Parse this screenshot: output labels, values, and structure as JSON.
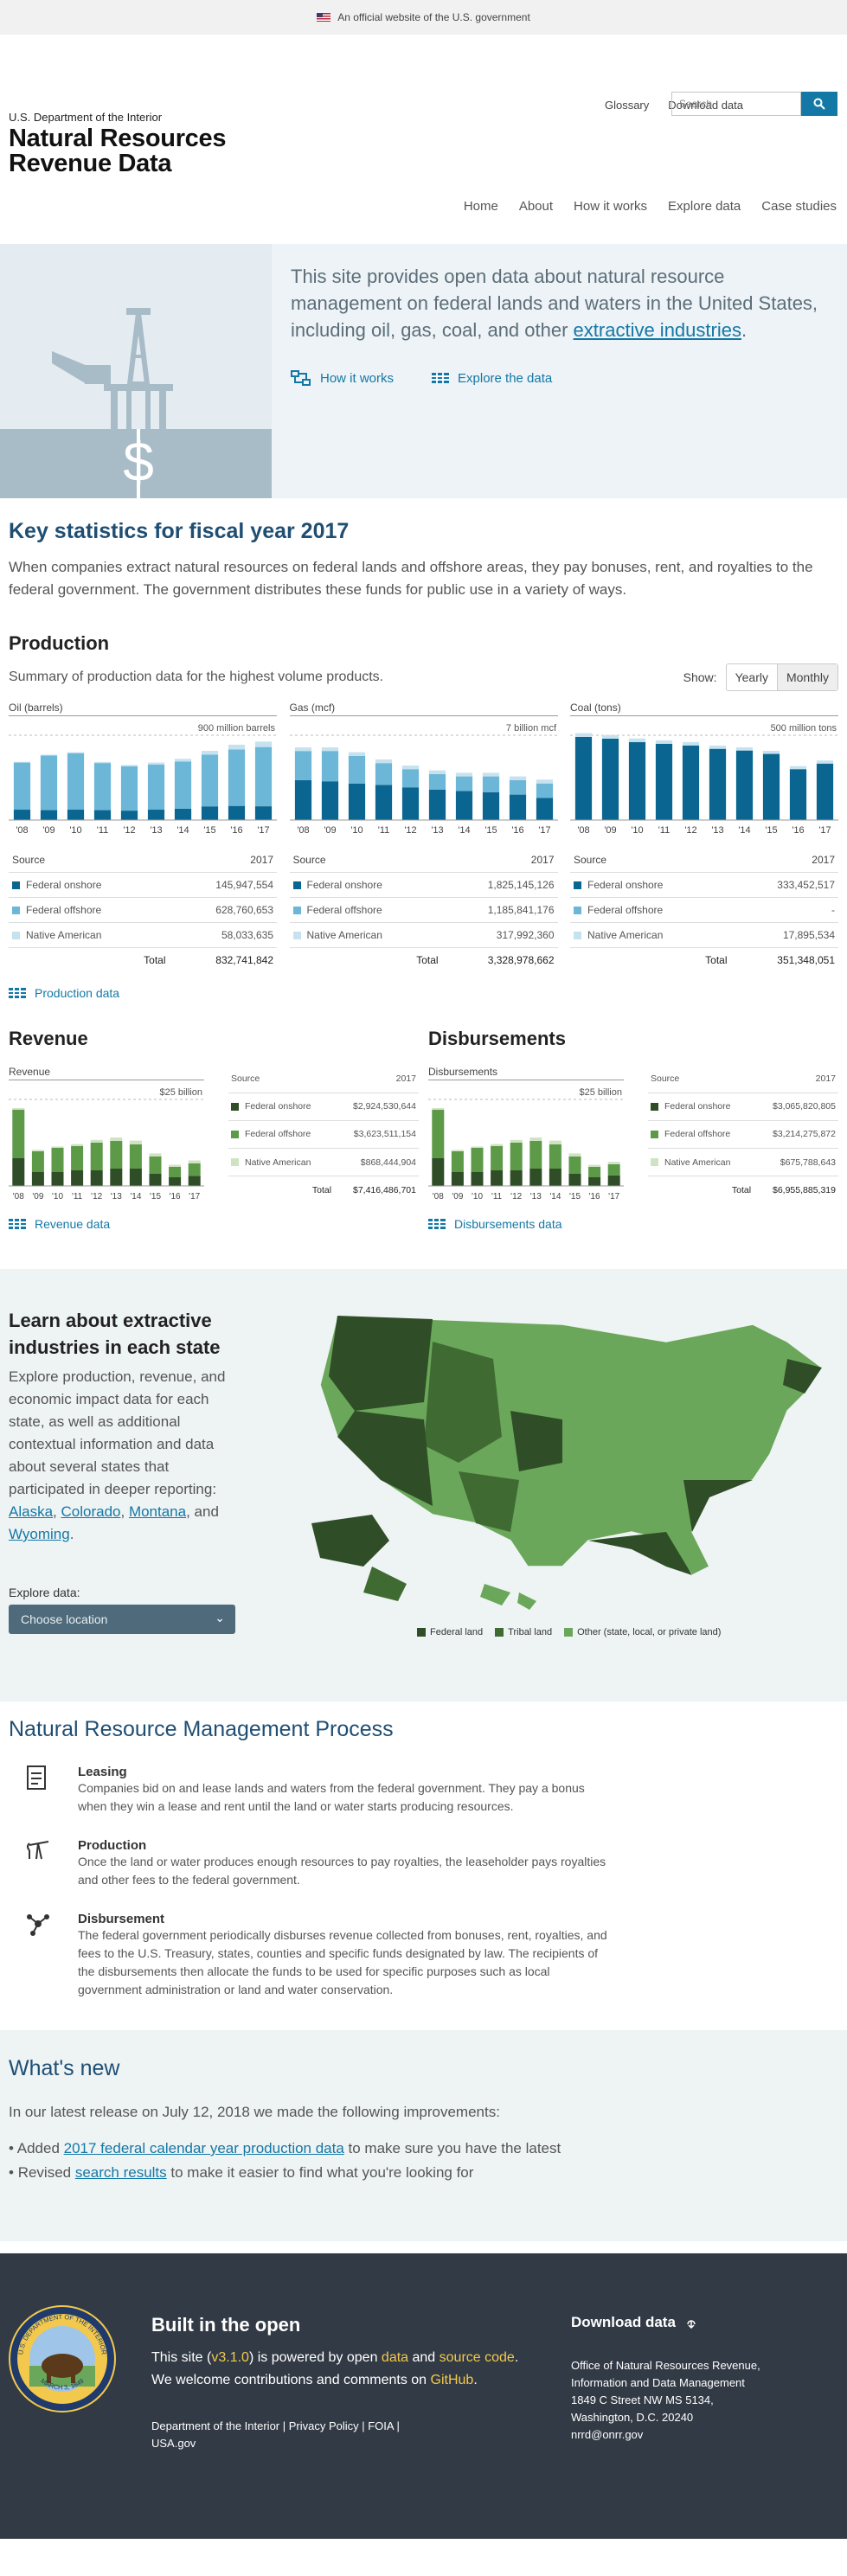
{
  "banner": {
    "text": "An official website of the U.S. government"
  },
  "header": {
    "department": "U.S. Department of the Interior",
    "title_line1": "Natural Resources",
    "title_line2": "Revenue Data",
    "glossary": "Glossary",
    "download": "Download data",
    "search_placeholder": "Search"
  },
  "nav": [
    "Home",
    "About",
    "How it works",
    "Explore data",
    "Case studies"
  ],
  "hero": {
    "text_before": "This site provides open data about natural resource management on federal lands and waters in the United States, including oil, gas, coal, and other ",
    "text_link": "extractive industries",
    "text_after": ".",
    "how_it_works": "How it works",
    "explore": "Explore the data"
  },
  "key": {
    "title": "Key statistics for fiscal year 2017",
    "desc": "When companies extract natural resources on federal lands and offshore areas, they pay bonuses, rent, and royalties to the federal government. The government distributes these funds for public use in a variety of ways."
  },
  "production": {
    "title": "Production",
    "desc": "Summary of production data for the highest volume products.",
    "show": "Show:",
    "yearly": "Yearly",
    "monthly": "Monthly",
    "link": "Production data"
  },
  "colors": {
    "onshore": "#0a6690",
    "offshore": "#6cb6d8",
    "native": "#c6e2ef",
    "rev_onshore": "#2f4d26",
    "rev_offshore": "#5c9a48",
    "rev_native": "#cfe3c3",
    "fed_land": "#2f4d26",
    "tribal": "#3f6b32",
    "other": "#6aa75a"
  },
  "tables": {
    "source": "Source",
    "year": "2017",
    "onshore": "Federal onshore",
    "offshore": "Federal offshore",
    "native": "Native American",
    "total": "Total"
  },
  "chart_data": [
    {
      "type": "bar",
      "title": "Oil (barrels)",
      "max_label": "900 million barrels",
      "categories": [
        "'08",
        "'09",
        "'10",
        "'11",
        "'12",
        "'13",
        "'14",
        "'15",
        "'16",
        "'17"
      ],
      "series": [
        {
          "name": "Federal onshore",
          "values": [
            110,
            105,
            110,
            105,
            100,
            110,
            120,
            145,
            150,
            146
          ]
        },
        {
          "name": "Federal offshore",
          "values": [
            500,
            580,
            600,
            500,
            470,
            480,
            500,
            550,
            600,
            629
          ]
        },
        {
          "name": "Native American",
          "values": [
            8,
            9,
            10,
            12,
            15,
            20,
            30,
            40,
            50,
            58
          ]
        }
      ],
      "ylim": [
        0,
        900
      ],
      "table": [
        "145,947,554",
        "628,760,653",
        "58,033,635",
        "832,741,842"
      ]
    },
    {
      "type": "bar",
      "title": "Gas (mcf)",
      "max_label": "7 billion mcf",
      "categories": [
        "'08",
        "'09",
        "'10",
        "'11",
        "'12",
        "'13",
        "'14",
        "'15",
        "'16",
        "'17"
      ],
      "series": [
        {
          "name": "Federal onshore",
          "values": [
            3.3,
            3.2,
            3.0,
            2.9,
            2.7,
            2.5,
            2.4,
            2.3,
            2.1,
            1.83
          ]
        },
        {
          "name": "Federal offshore",
          "values": [
            2.4,
            2.5,
            2.3,
            1.8,
            1.5,
            1.3,
            1.2,
            1.3,
            1.2,
            1.19
          ]
        },
        {
          "name": "Native American",
          "values": [
            0.3,
            0.3,
            0.3,
            0.3,
            0.3,
            0.3,
            0.3,
            0.3,
            0.3,
            0.32
          ]
        }
      ],
      "ylim": [
        0,
        7
      ],
      "table": [
        "1,825,145,126",
        "1,185,841,176",
        "317,992,360",
        "3,328,978,662"
      ]
    },
    {
      "type": "bar",
      "title": "Coal (tons)",
      "max_label": "500 million tons",
      "categories": [
        "'08",
        "'09",
        "'10",
        "'11",
        "'12",
        "'13",
        "'14",
        "'15",
        "'16",
        "'17"
      ],
      "series": [
        {
          "name": "Federal onshore",
          "values": [
            490,
            480,
            460,
            450,
            440,
            420,
            410,
            390,
            300,
            333
          ]
        },
        {
          "name": "Federal offshore",
          "values": [
            0,
            0,
            0,
            0,
            0,
            0,
            0,
            0,
            0,
            0
          ]
        },
        {
          "name": "Native American",
          "values": [
            22,
            21,
            21,
            20,
            20,
            19,
            19,
            18,
            18,
            18
          ]
        }
      ],
      "ylim": [
        0,
        500
      ],
      "table": [
        "333,452,517",
        "-",
        "17,895,534",
        "351,348,051"
      ]
    },
    {
      "type": "bar",
      "title": "Revenue",
      "max_label": "$25 billion",
      "categories": [
        "'08",
        "'09",
        "'10",
        "'11",
        "'12",
        "'13",
        "'14",
        "'15",
        "'16",
        "'17"
      ],
      "series": [
        {
          "name": "Federal onshore",
          "values": [
            8,
            4,
            4,
            4.5,
            4.5,
            5,
            5,
            3.5,
            2.5,
            2.9
          ]
        },
        {
          "name": "Federal offshore",
          "values": [
            14,
            6,
            7,
            7,
            8,
            8,
            7,
            5,
            3,
            3.6
          ]
        },
        {
          "name": "Native American",
          "values": [
            0.5,
            0.4,
            0.4,
            0.6,
            0.8,
            1.0,
            1.1,
            0.9,
            0.6,
            0.87
          ]
        }
      ],
      "ylim": [
        0,
        25
      ],
      "table": [
        "$2,924,530,644",
        "$3,623,511,154",
        "$868,444,904",
        "$7,416,486,701"
      ],
      "link": "Revenue data",
      "section_title": "Revenue"
    },
    {
      "type": "bar",
      "title": "Disbursements",
      "max_label": "$25 billion",
      "categories": [
        "'08",
        "'09",
        "'10",
        "'11",
        "'12",
        "'13",
        "'14",
        "'15",
        "'16",
        "'17"
      ],
      "series": [
        {
          "name": "Federal onshore",
          "values": [
            8,
            4,
            4,
            4.5,
            4.5,
            5,
            5,
            3.5,
            2.5,
            3.07
          ]
        },
        {
          "name": "Federal offshore",
          "values": [
            14,
            6,
            7,
            7,
            8,
            8,
            7,
            5,
            3,
            3.2
          ]
        },
        {
          "name": "Native American",
          "values": [
            0.5,
            0.4,
            0.4,
            0.6,
            0.8,
            1.0,
            1.1,
            0.9,
            0.6,
            0.68
          ]
        }
      ],
      "ylim": [
        0,
        25
      ],
      "table": [
        "$3,065,820,805",
        "$3,214,275,872",
        "$675,788,643",
        "$6,955,885,319"
      ],
      "link": "Disbursements data",
      "section_title": "Disbursements"
    }
  ],
  "states": {
    "title": "Learn about extractive industries in each state",
    "desc": "Explore production, revenue, and economic impact data for each state, as well as additional contextual information and data about several states that participated in deeper reporting:",
    "s1": "Alaska",
    "s2": "Colorado",
    "s3": "Montana",
    "and": ", and",
    "s4": "Wyoming",
    "explore": "Explore data:",
    "select": "Choose location",
    "legend_fed": "Federal land",
    "legend_tribal": "Tribal land",
    "legend_other": "Other (state, local, or private land)"
  },
  "process": {
    "title": "Natural Resource Management Process",
    "steps": [
      {
        "title": "Leasing",
        "text": "Companies bid on and lease lands and waters from the federal government.  They pay a bonus when they win a lease and rent until the land or water starts producing resources."
      },
      {
        "title": "Production",
        "text": "Once the land or water produces enough resources to pay royalties, the leaseholder pays royalties and other fees to the federal government."
      },
      {
        "title": "Disbursement",
        "text": "The federal government periodically disburses revenue collected from bonuses, rent, royalties, and fees to the U.S. Treasury, states, counties and specific funds designated by law.  The recipients of the disbursements then allocate the funds to be used for specific purposes such as local government administration or land and water conservation."
      }
    ]
  },
  "whatsnew": {
    "title": "What's new",
    "intro": "In our latest release on July 12, 2018 we made the following improvements:",
    "i1_pre": "Added ",
    "i1_link": "2017 federal calendar year production data",
    "i1_post": " to make sure you have the latest",
    "i2_pre": "Revised ",
    "i2_link": "search results",
    "i2_post": " to make it easier to find what you're looking for"
  },
  "footer": {
    "title": "Built in the open",
    "l1_pre": "This site (",
    "version": "v3.1.0",
    "l1_mid": ") is powered by open ",
    "data": "data",
    "and": " and ",
    "source": "source code",
    "l1_end": ".",
    "l2_pre": "We welcome contributions and comments on ",
    "github": "GitHub",
    "l2_end": ".",
    "links": "Department of the Interior | Privacy Policy | FOIA |",
    "usa": "USA.gov",
    "download": "Download data",
    "addr1": "Office of Natural Resources Revenue,",
    "addr2": "Information and Data Management",
    "addr3": "1849 C Street NW MS 5134,",
    "addr4": "Washington, D.C. 20240",
    "addr5": "nrrd@onrr.gov",
    "seal_top": "U.S. DEPARTMENT OF THE INTERIOR",
    "seal_bottom": "MARCH 3, 1849"
  }
}
